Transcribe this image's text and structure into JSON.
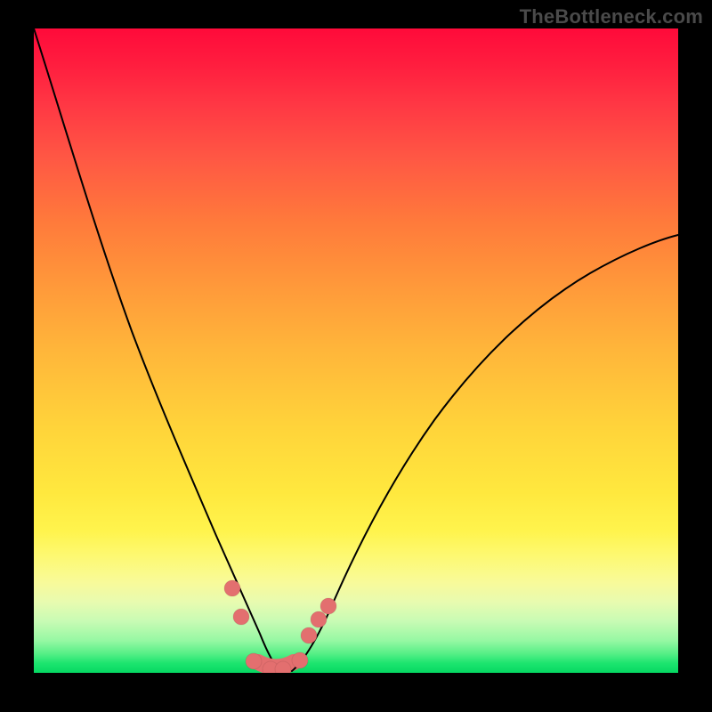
{
  "watermark": "TheBottleneck.com",
  "chart_data": {
    "type": "line",
    "title": "",
    "xlabel": "",
    "ylabel": "",
    "xlim": [
      0,
      100
    ],
    "ylim": [
      0,
      100
    ],
    "grid": false,
    "legend": false,
    "series": [
      {
        "name": "bottleneck-curve",
        "x": [
          0,
          5,
          10,
          15,
          20,
          25,
          30,
          32,
          34,
          36,
          38,
          40,
          44,
          48,
          55,
          65,
          75,
          85,
          95,
          100
        ],
        "values": [
          100,
          82,
          65,
          50,
          37,
          25,
          14,
          10,
          6,
          2,
          0,
          0,
          2,
          6,
          14,
          28,
          41,
          53,
          63,
          67
        ]
      }
    ],
    "markers": {
      "name": "highlighted-points",
      "color": "#e36f6f",
      "x": [
        30.5,
        32.0,
        34.0,
        36.5,
        38.5,
        41.0,
        42.5,
        44.0,
        45.5
      ],
      "values": [
        13.5,
        9.0,
        2.0,
        0.5,
        0.5,
        2.0,
        6.0,
        8.5,
        10.5
      ]
    },
    "colors": {
      "curve": "#000000",
      "marker": "#e36f6f",
      "gradient_top": "#ff0a3a",
      "gradient_bottom": "#05d862"
    }
  }
}
